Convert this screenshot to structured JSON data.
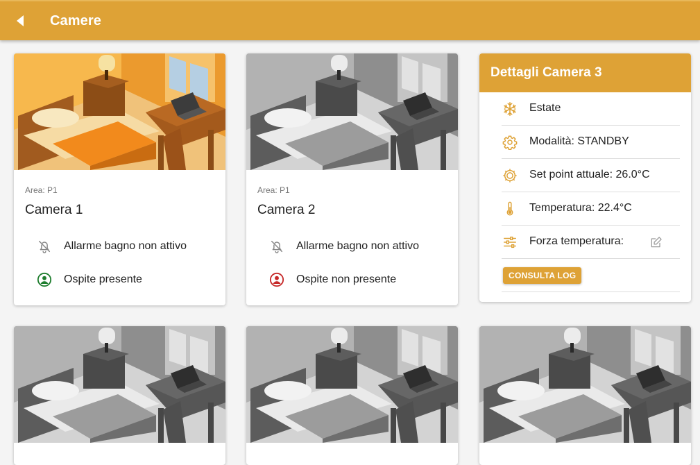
{
  "header": {
    "title": "Camere",
    "back_icon": "back-arrow-icon",
    "color": "#dea236"
  },
  "rooms": [
    {
      "area": "Area: P1",
      "name": "Camera 1",
      "active": true,
      "alarm": {
        "icon": "bell-off-icon",
        "text": "Allarme bagno non attivo"
      },
      "guest": {
        "icon": "user-circle-icon",
        "text": "Ospite presente",
        "color": "#1e7d2e"
      }
    },
    {
      "area": "Area: P1",
      "name": "Camera 2",
      "active": false,
      "alarm": {
        "icon": "bell-off-icon",
        "text": "Allarme bagno non attivo"
      },
      "guest": {
        "icon": "user-circle-icon",
        "text": "Ospite non presente",
        "color": "#c62828"
      }
    }
  ],
  "details": {
    "title": "Dettagli Camera 3",
    "rows": [
      {
        "icon": "snowflake-icon",
        "text": "Estate"
      },
      {
        "icon": "gear-icon",
        "text": "Modalità: STANDBY"
      },
      {
        "icon": "setpoint-icon",
        "text": "Set point attuale: 26.0°C"
      },
      {
        "icon": "thermometer-icon",
        "text": "Temperatura: 22.4°C"
      },
      {
        "icon": "sliders-icon",
        "text": "Forza temperatura:"
      }
    ],
    "edit_icon": "edit-icon",
    "log_button": "CONSULTA LOG"
  },
  "colors": {
    "accent": "#dea236",
    "guest_present": "#1e7d2e",
    "guest_absent": "#c62828"
  }
}
